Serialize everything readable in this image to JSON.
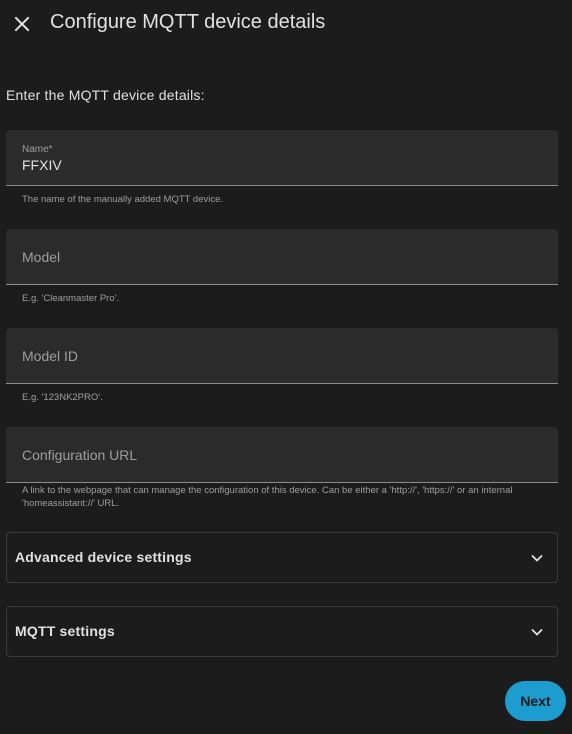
{
  "dialog": {
    "title": "Configure MQTT device details",
    "close_icon": "close-icon",
    "intro": "Enter the MQTT device details:"
  },
  "fields": {
    "name": {
      "label": "Name*",
      "value": "FFXIV",
      "helper": "The name of the manually added MQTT device."
    },
    "model": {
      "label": "Model",
      "value": "",
      "helper": "E.g. 'Cleanmaster Pro'."
    },
    "model_id": {
      "label": "Model ID",
      "value": "",
      "helper": "E.g. '123NK2PRO'."
    },
    "configuration_url": {
      "label": "Configuration URL",
      "value": "",
      "helper": "A link to the webpage that can manage the configuration of this device. Can be either a 'http://', 'https://' or an internal 'homeassistant://' URL."
    }
  },
  "expanders": {
    "advanced": {
      "label": "Advanced device settings",
      "icon": "chevron-down-icon"
    },
    "mqtt": {
      "label": "MQTT settings",
      "icon": "chevron-down-icon"
    }
  },
  "actions": {
    "next_label": "Next"
  },
  "colors": {
    "background": "#1c1c1c",
    "field_bg": "#2b2b2b",
    "accent": "#1d9dcf",
    "text": "#e1e1e1",
    "muted": "#9e9e9e"
  }
}
